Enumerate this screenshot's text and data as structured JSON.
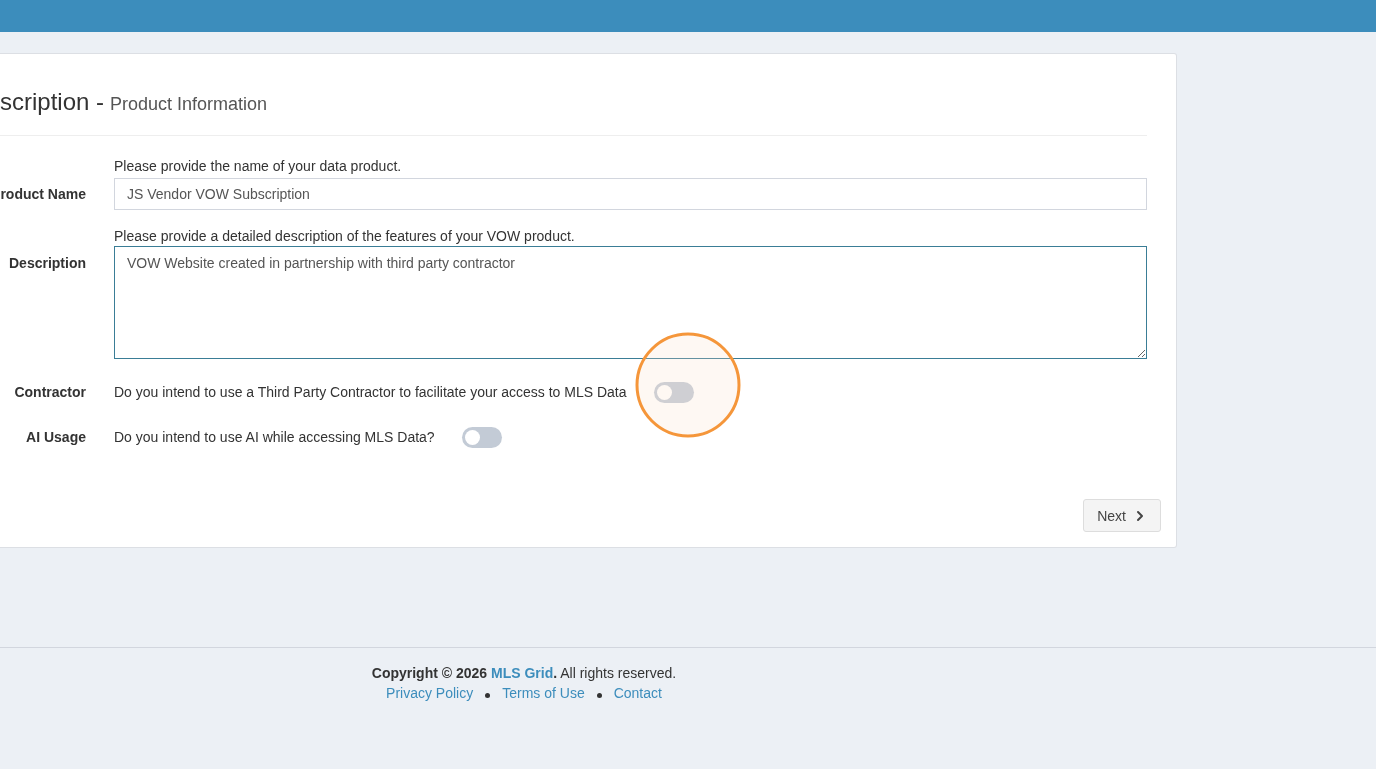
{
  "card": {
    "title": "scription -",
    "subtitle": "Product Information",
    "fields": [
      {
        "kind": "text",
        "label": "roduct Name",
        "help": "Please provide the name of your data product.",
        "value": "JS Vendor VOW Subscription",
        "focused": false
      },
      {
        "kind": "textarea",
        "label": "Description",
        "help": "Please provide a detailed description of the features of your VOW product.",
        "value": "VOW Website created in partnership with third party contractor",
        "focused": true
      },
      {
        "kind": "toggle",
        "label": "Contractor",
        "question": "Do you intend to use a Third Party Contractor to facilitate your access to MLS Data",
        "on": false
      },
      {
        "kind": "toggle",
        "label": "AI Usage",
        "question": "Do you intend to use AI while accessing MLS Data?",
        "on": false
      }
    ],
    "next_button": "Next"
  },
  "footer": {
    "copyright": {
      "prefix": "**Copyright © 2026**",
      "link": "MLS Grid",
      "suffix": "**.** All rights reserved."
    },
    "links": [
      "Privacy Policy",
      "Terms of Use",
      "Contact"
    ]
  }
}
